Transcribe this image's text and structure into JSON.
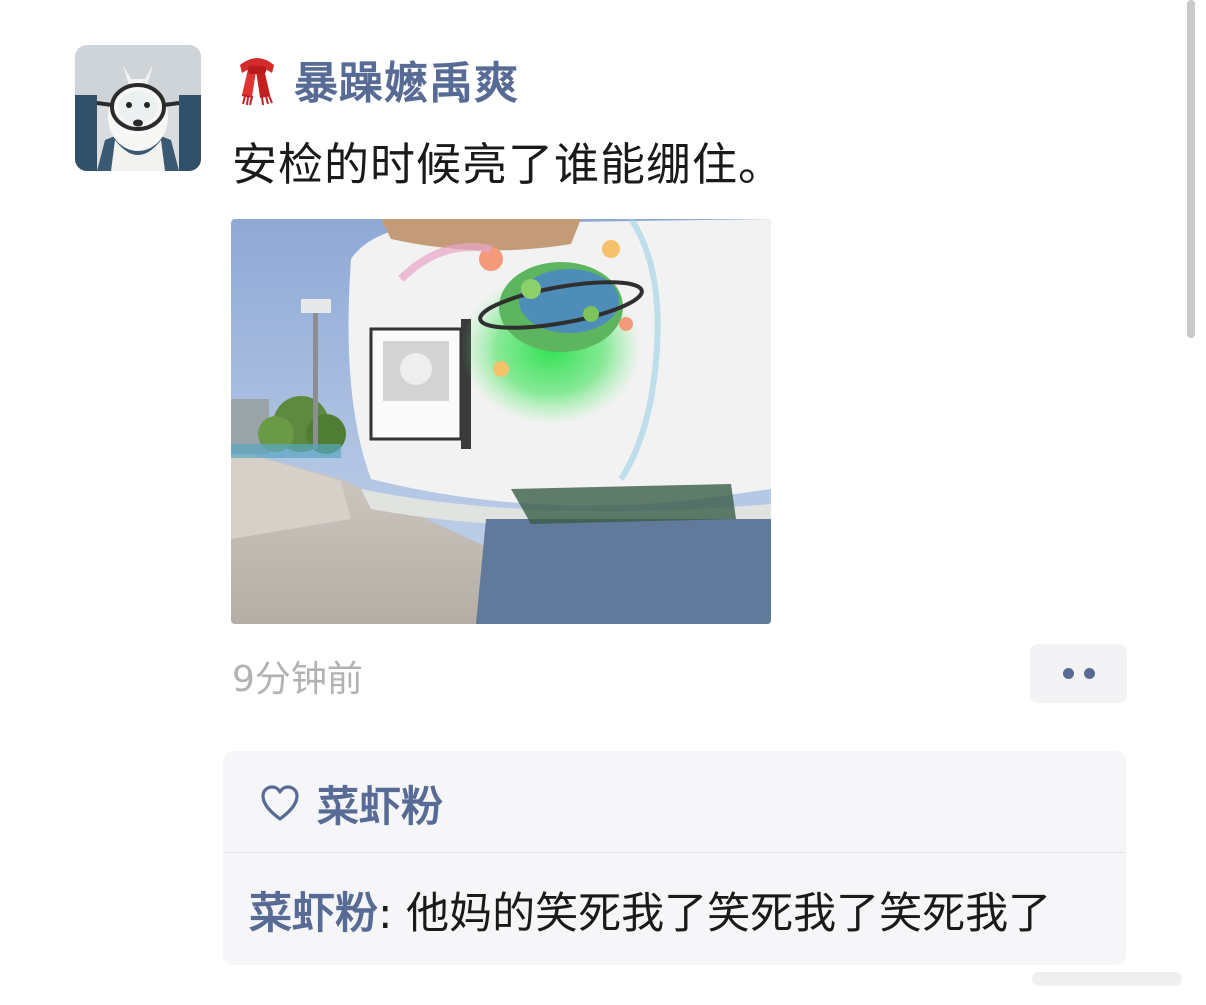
{
  "post": {
    "author_icon": "red-scarf-icon",
    "author": "暴躁嬷禹爽",
    "text": "安检的时候亮了谁能绷住。",
    "time": "9分钟前",
    "more_icon": "two-dots-icon"
  },
  "likes": {
    "icon": "heart-outline-icon",
    "names": "菜虾粉"
  },
  "comments": [
    {
      "user": "菜虾粉",
      "separator": ": ",
      "text": "他妈的笑死我了笑死我了笑死我了"
    }
  ],
  "colors": {
    "link_blue": "#576b95",
    "time_gray": "#b2b2b2",
    "comment_bg": "#f6f6f8"
  }
}
